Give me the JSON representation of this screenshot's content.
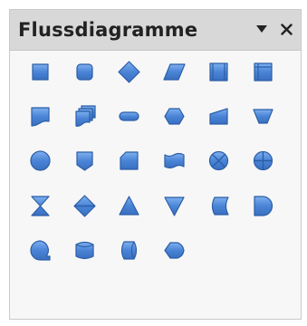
{
  "toolbar": {
    "title": "Flussdiagramme",
    "menu_icon": "triangle-down-icon",
    "close_icon": "close-icon",
    "accent": "#4a84d6",
    "accent_dark": "#2b5ea7"
  },
  "tools": [
    {
      "name": "process",
      "icon": "flowchart-process-icon",
      "row": 0,
      "col": 0
    },
    {
      "name": "alternate-process",
      "icon": "flowchart-alternate-process-icon",
      "row": 0,
      "col": 1
    },
    {
      "name": "decision",
      "icon": "flowchart-decision-icon",
      "row": 0,
      "col": 2
    },
    {
      "name": "data",
      "icon": "flowchart-data-icon",
      "row": 0,
      "col": 3
    },
    {
      "name": "predefined-process",
      "icon": "flowchart-predefined-process-icon",
      "row": 0,
      "col": 4
    },
    {
      "name": "internal-storage",
      "icon": "flowchart-internal-storage-icon",
      "row": 0,
      "col": 5
    },
    {
      "name": "document",
      "icon": "flowchart-document-icon",
      "row": 1,
      "col": 0
    },
    {
      "name": "multidocument",
      "icon": "flowchart-multidocument-icon",
      "row": 1,
      "col": 1
    },
    {
      "name": "terminator",
      "icon": "flowchart-terminator-icon",
      "row": 1,
      "col": 2
    },
    {
      "name": "preparation",
      "icon": "flowchart-preparation-icon",
      "row": 1,
      "col": 3
    },
    {
      "name": "manual-input",
      "icon": "flowchart-manual-input-icon",
      "row": 1,
      "col": 4
    },
    {
      "name": "manual-operation",
      "icon": "flowchart-manual-operation-icon",
      "row": 1,
      "col": 5
    },
    {
      "name": "connector",
      "icon": "flowchart-connector-icon",
      "row": 2,
      "col": 0
    },
    {
      "name": "off-page-connector",
      "icon": "flowchart-off-page-connector-icon",
      "row": 2,
      "col": 1
    },
    {
      "name": "card",
      "icon": "flowchart-card-icon",
      "row": 2,
      "col": 2
    },
    {
      "name": "punched-tape",
      "icon": "flowchart-punched-tape-icon",
      "row": 2,
      "col": 3
    },
    {
      "name": "summing-junction",
      "icon": "flowchart-summing-junction-icon",
      "row": 2,
      "col": 4
    },
    {
      "name": "or",
      "icon": "flowchart-or-icon",
      "row": 2,
      "col": 5
    },
    {
      "name": "collate",
      "icon": "flowchart-collate-icon",
      "row": 3,
      "col": 0
    },
    {
      "name": "sort",
      "icon": "flowchart-sort-icon",
      "row": 3,
      "col": 1
    },
    {
      "name": "extract",
      "icon": "flowchart-extract-icon",
      "row": 3,
      "col": 2
    },
    {
      "name": "merge",
      "icon": "flowchart-merge-icon",
      "row": 3,
      "col": 3
    },
    {
      "name": "stored-data",
      "icon": "flowchart-stored-data-icon",
      "row": 3,
      "col": 4
    },
    {
      "name": "delay",
      "icon": "flowchart-delay-icon",
      "row": 3,
      "col": 5
    },
    {
      "name": "sequential-access",
      "icon": "flowchart-sequential-access-icon",
      "row": 4,
      "col": 0
    },
    {
      "name": "magnetic-disc",
      "icon": "flowchart-magnetic-disc-icon",
      "row": 4,
      "col": 1
    },
    {
      "name": "direct-access-storage",
      "icon": "flowchart-direct-access-storage-icon",
      "row": 4,
      "col": 2
    },
    {
      "name": "display",
      "icon": "flowchart-display-icon",
      "row": 4,
      "col": 3
    }
  ]
}
